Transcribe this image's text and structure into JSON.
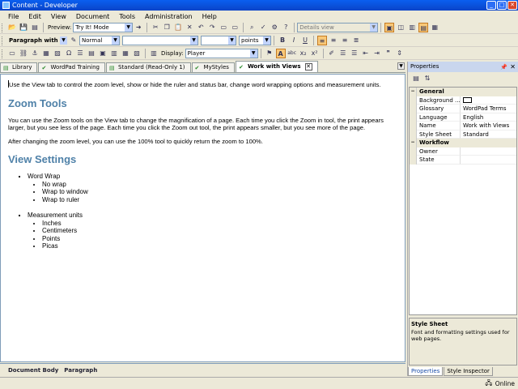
{
  "window": {
    "title": "Content - Developer"
  },
  "menu": [
    "File",
    "Edit",
    "View",
    "Document",
    "Tools",
    "Administration",
    "Help"
  ],
  "toolbar1": {
    "preview_label": "Preview:",
    "preview_mode": "Try It! Mode",
    "view_select": "Details view"
  },
  "toolbar2": {
    "paragraph_style": "Paragraph with 8 ...",
    "style_select": "Normal",
    "font_select": "",
    "size_select": "",
    "unit_select": "points",
    "bold": "B",
    "italic": "I",
    "underline": "U"
  },
  "toolbar3": {
    "display_label": "Display:",
    "display_select": "Player",
    "abc": "abc",
    "sub": "x₂",
    "sup": "x²"
  },
  "tabs": [
    {
      "label": "Library"
    },
    {
      "label": "WordPad Training"
    },
    {
      "label": "Standard (Read-Only 1)"
    },
    {
      "label": "MyStyles"
    },
    {
      "label": "Work with Views",
      "active": true
    }
  ],
  "document": {
    "intro": "Use the View tab to control the zoom level, show or hide the ruler and status bar, change word wrapping options and measurement units.",
    "h_zoom": "Zoom Tools",
    "p_zoom1": "You can use the Zoom tools on the View tab to change the magnification of a page. Each time you click the Zoom in tool, the print appears larger, but you see less of the page. Each time you click the Zoom out tool, the print appears smaller, but you see more of the page.",
    "p_zoom2": "After changing the zoom level, you can use the 100% tool to quickly return the zoom to 100%.",
    "h_view": "View Settings",
    "list": [
      {
        "label": "Word Wrap",
        "items": [
          "No wrap",
          "Wrap to window",
          "Wrap to ruler"
        ]
      },
      {
        "label": "Measurement units",
        "items": [
          "Inches",
          "Centimeters",
          "Points",
          "Picas"
        ]
      }
    ]
  },
  "doc_status": {
    "left": "Document Body",
    "right": "Paragraph"
  },
  "properties": {
    "title": "Properties",
    "general_label": "General",
    "rows_general": [
      {
        "key": "Background ...",
        "value": ""
      },
      {
        "key": "Glossary",
        "value": "WordPad Terms"
      },
      {
        "key": "Language",
        "value": "English"
      },
      {
        "key": "Name",
        "value": "Work with Views"
      },
      {
        "key": "Style Sheet",
        "value": "Standard"
      }
    ],
    "workflow_label": "Workflow",
    "rows_workflow": [
      {
        "key": "Owner",
        "value": ""
      },
      {
        "key": "State",
        "value": ""
      }
    ],
    "desc_title": "Style Sheet",
    "desc_text": "Font and formatting settings used for web pages.",
    "tab_properties": "Properties",
    "tab_inspector": "Style Inspector"
  },
  "status": {
    "online": "Online"
  }
}
